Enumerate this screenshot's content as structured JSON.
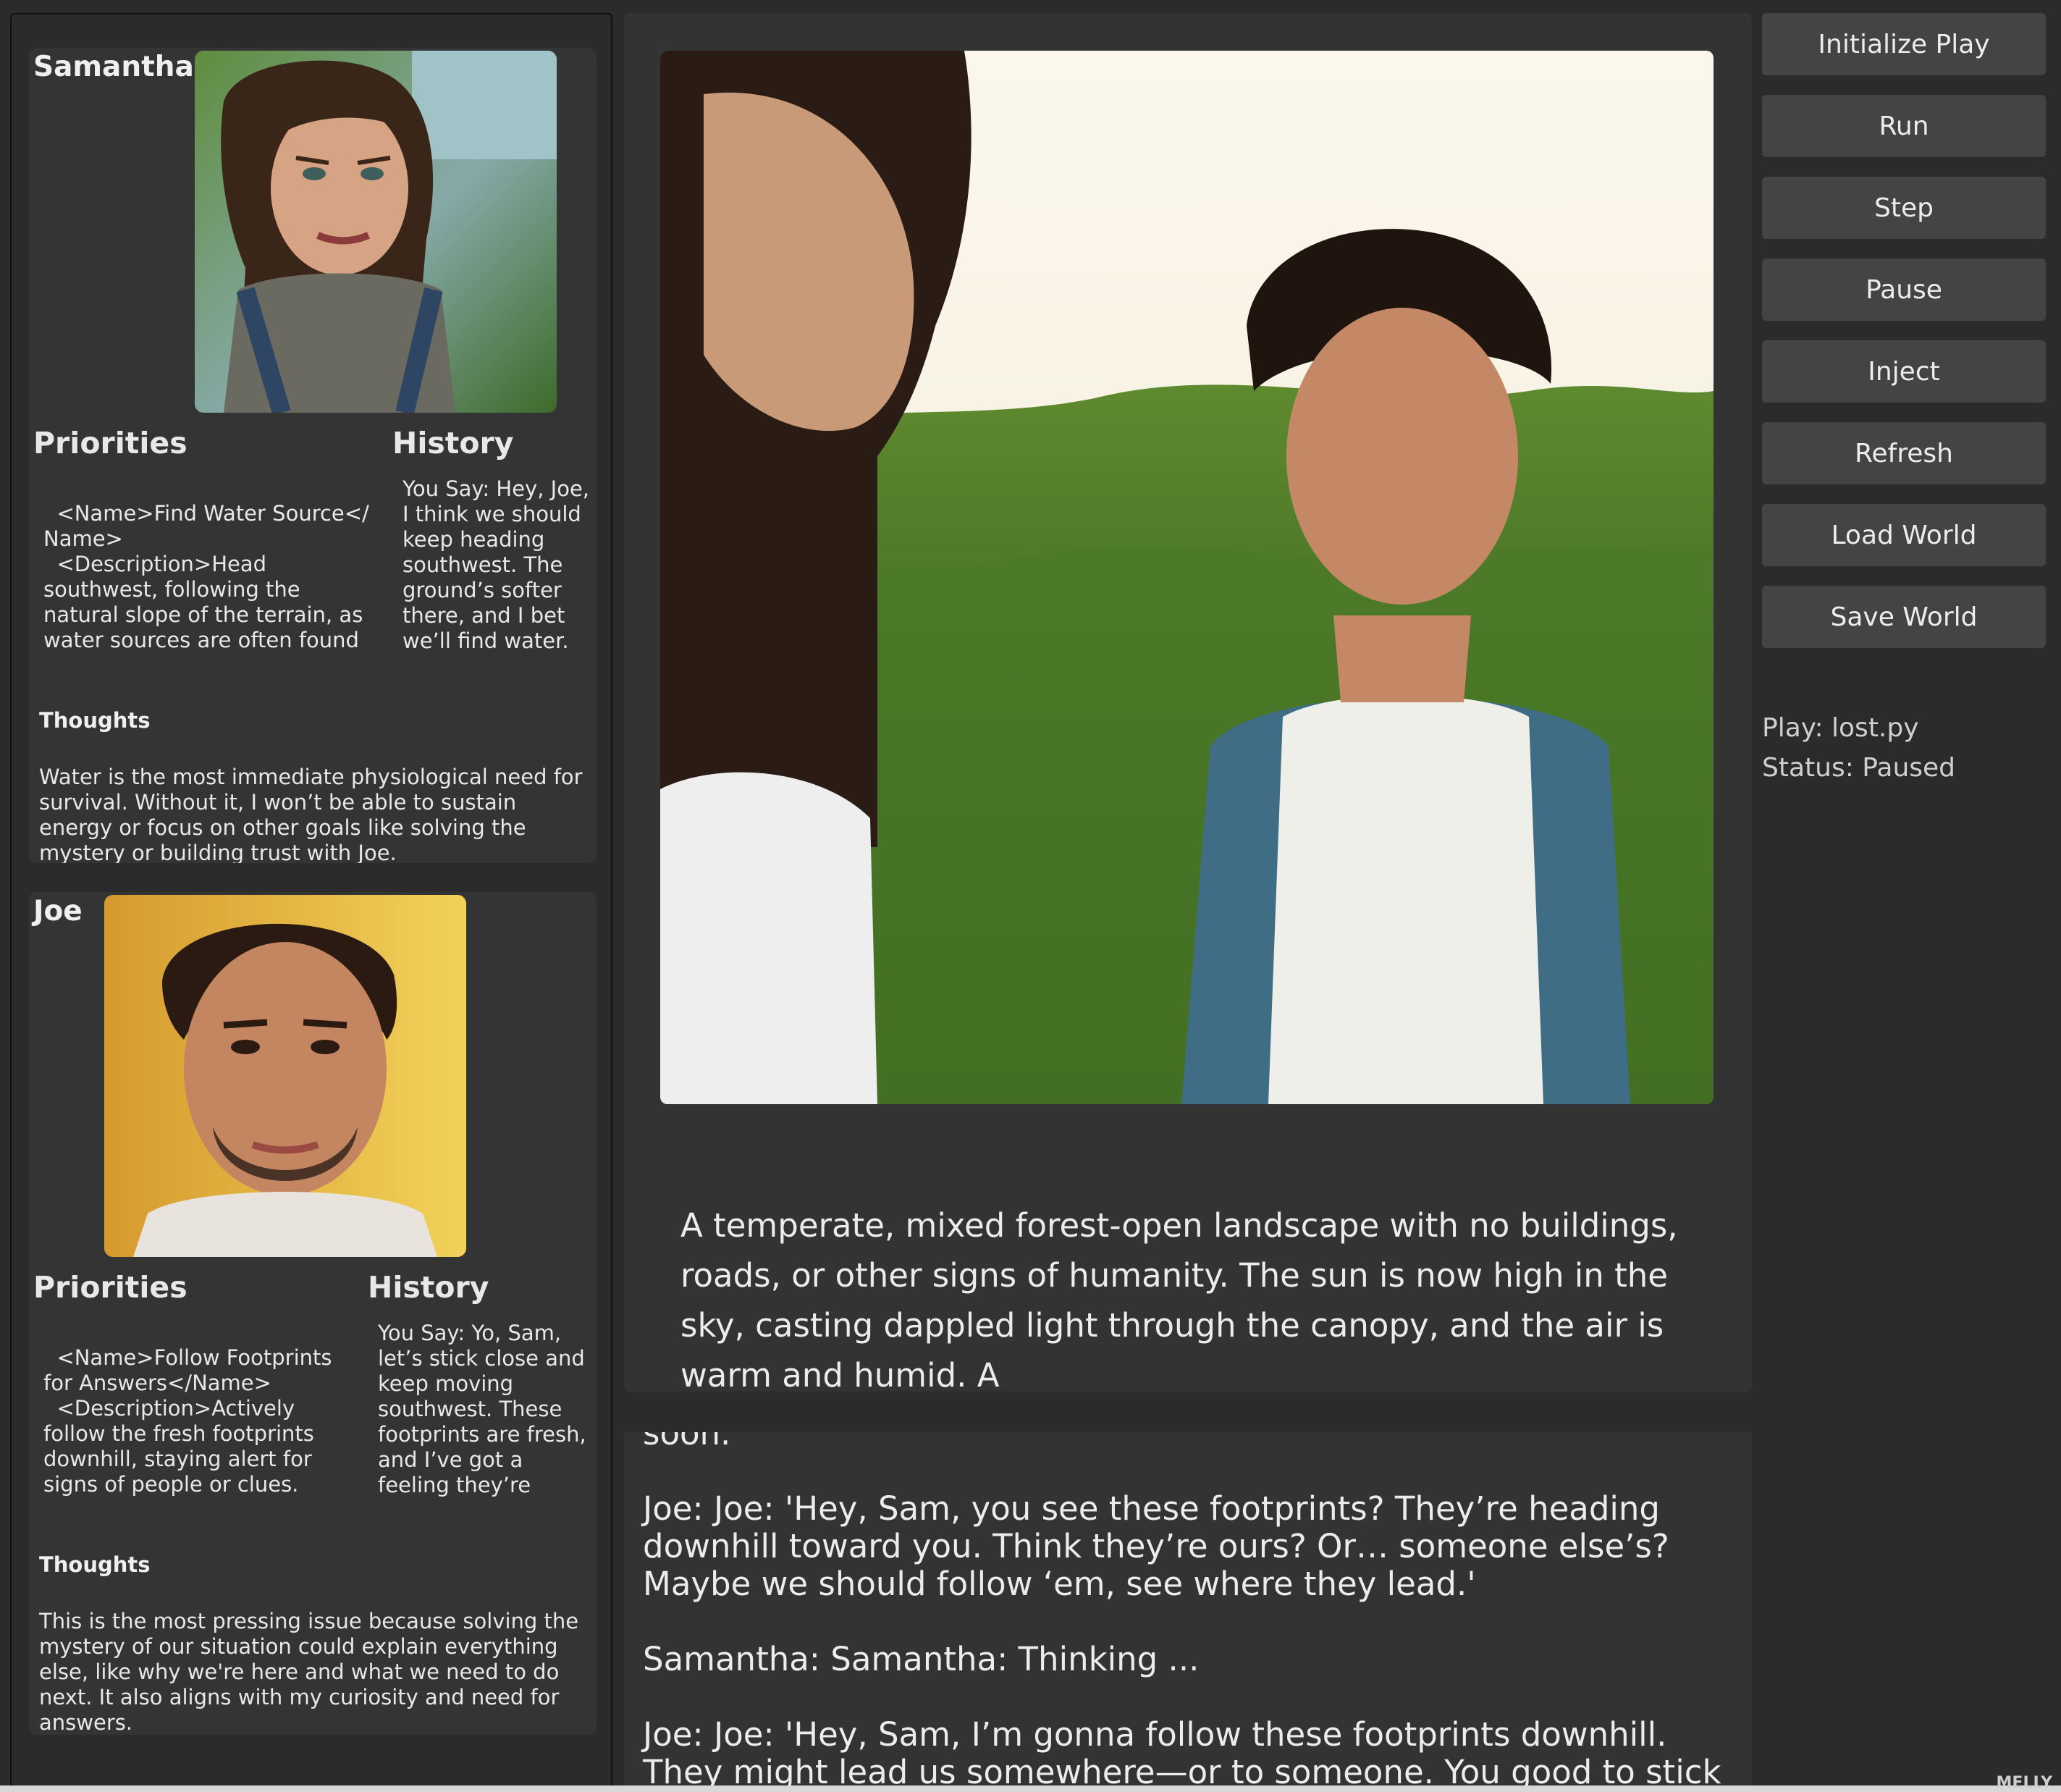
{
  "characters": [
    {
      "name": "Samantha",
      "portrait_icon": "samantha-portrait",
      "priorities_title": "Priorities",
      "priorities_text": "  <Name>Find Water Source</\nName>\n  <Description>Head southwest, following the natural slope of the terrain, as water sources are often found in lower elevations. Keep an eye out for signs of",
      "history_title": "History",
      "history_text": "You Say: Hey, Joe, I think we should keep heading southwest. The ground’s softer there, and I bet we’ll find water. Plus, those",
      "thoughts_title": "Thoughts",
      "thoughts_text": "Water is the most immediate physiological need for survival. Without it, I won’t be able to sustain energy or focus on other goals like solving the mystery or building trust with Joe."
    },
    {
      "name": "Joe",
      "portrait_icon": "joe-portrait",
      "priorities_title": "Priorities",
      "priorities_text": "  <Name>Follow Footprints for Answers</Name>\n  <Description>Actively follow the fresh footprints downhill, staying alert for signs of people or clues. Keep Samantha close and",
      "history_title": "History",
      "history_text": "You Say: Yo, Sam, let’s stick close and keep moving southwest. These footprints are fresh, and I’ve got a feeling they’re gonna lead us",
      "thoughts_title": "Thoughts",
      "thoughts_text": "This is the most pressing issue because solving the mystery of our situation could explain everything else, like why we're here and what we need to do next. It also aligns with my curiosity and need for answers."
    }
  ],
  "scene": {
    "image_icon": "scene-illustration",
    "description": "A temperate, mixed forest-open landscape with no buildings, roads, or other signs of humanity. The sun is now high in the sky, casting dappled light through the canopy, and the air is warm and humid. A"
  },
  "log": {
    "lines": [
      "soon.",
      "Joe: Joe: 'Hey, Sam, you see these footprints? They’re heading downhill toward you. Think they’re ours? Or… someone else’s? Maybe we should follow ‘em, see where they lead.'",
      "Samantha: Samantha: Thinking ...",
      "Joe: Joe: 'Hey, Sam, I’m gonna follow these footprints downhill. They might lead us somewhere—or to someone. You good to stick together? I"
    ]
  },
  "controls": {
    "buttons": [
      "Initialize Play",
      "Run",
      "Step",
      "Pause",
      "Inject",
      "Refresh",
      "Load World",
      "Save World"
    ]
  },
  "status": {
    "play": "Play: lost.py",
    "status": "Status: Paused"
  },
  "corner_text": "MELLY"
}
